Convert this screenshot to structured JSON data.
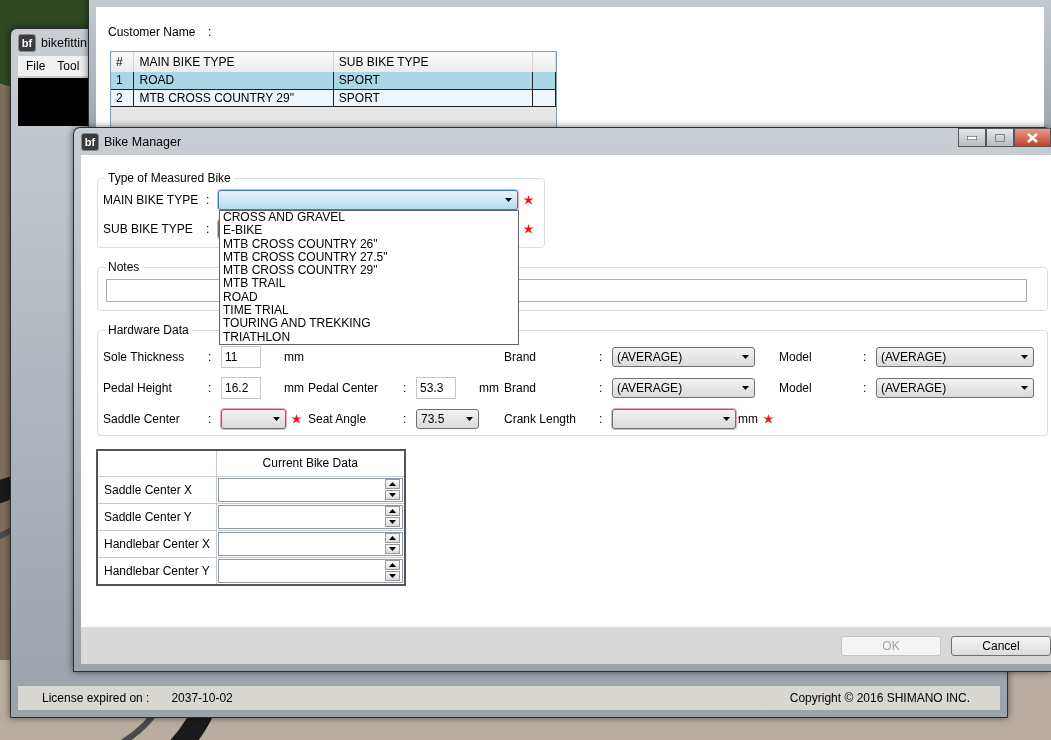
{
  "main_window": {
    "icon_text": "bf",
    "title": "bikefittin",
    "menu": [
      "File",
      "Tool"
    ],
    "status_bar": {
      "license_label": "License expired on :",
      "license_date": "2037-10-02",
      "copyright": "Copyright © 2016 SHIMANO INC."
    }
  },
  "customer_window": {
    "customer_label": "Customer Name",
    "separator": ":",
    "table": {
      "columns": [
        "#",
        "MAIN BIKE TYPE",
        "SUB BIKE TYPE"
      ],
      "rows": [
        {
          "cells": [
            "1",
            "ROAD",
            "SPORT"
          ],
          "selected": true
        },
        {
          "cells": [
            "2",
            "MTB CROSS COUNTRY 29\"",
            "SPORT"
          ],
          "selected": false
        }
      ]
    }
  },
  "bike_manager": {
    "icon_text": "bf",
    "title": "Bike Manager",
    "type_group": {
      "legend": "Type of Measured Bike",
      "fields": [
        {
          "label": "MAIN BIKE TYPE",
          "separator": ":",
          "required": true,
          "expanded": true,
          "options": [
            "CROSS AND GRAVEL",
            "E-BIKE",
            "MTB CROSS COUNTRY 26\"",
            "MTB CROSS COUNTRY 27.5\"",
            "MTB CROSS COUNTRY 29\"",
            "MTB TRAIL",
            "ROAD",
            "TIME TRIAL",
            "TOURING AND TREKKING",
            "TRIATHLON"
          ]
        },
        {
          "label": "SUB BIKE TYPE",
          "separator": ":",
          "required": true,
          "expanded": false
        }
      ]
    },
    "notes": {
      "legend": "Notes"
    },
    "hardware_data": {
      "legend": "Hardware Data",
      "rows": [
        {
          "left": [
            {
              "label": "Sole Thickness",
              "separator": ":",
              "control": {
                "kind": "text",
                "value": "11"
              },
              "unit": "mm",
              "required": false
            }
          ],
          "right": [
            {
              "label": "Brand",
              "separator": ":",
              "control": {
                "kind": "select",
                "value": "(AVERAGE)"
              },
              "required": false
            },
            {
              "label": "Model",
              "separator": ":",
              "control": {
                "kind": "select",
                "value": "(AVERAGE)"
              },
              "required": false
            }
          ]
        },
        {
          "left": [
            {
              "label": "Pedal Height",
              "separator": ":",
              "control": {
                "kind": "text",
                "value": "16.2"
              },
              "unit": "mm",
              "required": false
            },
            {
              "label": "Pedal Center",
              "separator": ":",
              "control": {
                "kind": "text",
                "value": "53.3"
              },
              "unit": "mm",
              "required": false
            }
          ],
          "right": [
            {
              "label": "Brand",
              "separator": ":",
              "control": {
                "kind": "select",
                "value": "(AVERAGE)"
              },
              "required": false
            },
            {
              "label": "Model",
              "separator": ":",
              "control": {
                "kind": "select",
                "value": "(AVERAGE)"
              },
              "required": false
            }
          ]
        },
        {
          "left": [
            {
              "label": "Saddle Center",
              "separator": ":",
              "control": {
                "kind": "select"
              },
              "required": true
            },
            {
              "label": "Seat Angle",
              "separator": ":",
              "control": {
                "kind": "select",
                "value": "73.5"
              },
              "required": false
            }
          ],
          "right": [
            {
              "label": "Crank Length",
              "separator": ":",
              "control": {
                "kind": "select"
              },
              "unit": "mm",
              "required": true
            }
          ]
        }
      ]
    },
    "bike_data_table": {
      "header": "Current Bike Data",
      "rows": [
        "Saddle Center X",
        "Saddle Center Y",
        "Handlebar Center X",
        "Handlebar Center Y"
      ]
    },
    "buttons": [
      {
        "label": "OK",
        "disabled": true
      },
      {
        "label": "Cancel",
        "disabled": false
      }
    ]
  }
}
